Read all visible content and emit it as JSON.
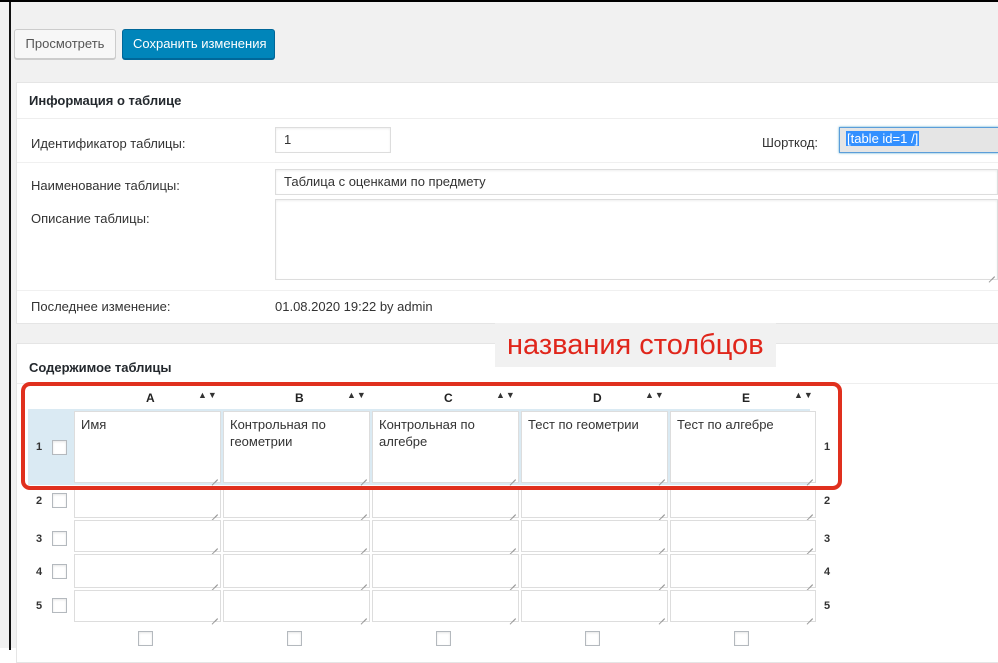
{
  "toolbar": {
    "preview_label": "Просмотреть",
    "save_label": "Сохранить изменения"
  },
  "info": {
    "title": "Информация о таблице",
    "id_label": "Идентификатор таблицы:",
    "id_value": "1",
    "shortcode_label": "Шорткод:",
    "shortcode_value": "[table id=1 /]",
    "name_label": "Наименование таблицы:",
    "name_value": "Таблица с оценками по предмету",
    "description_label": "Описание таблицы:",
    "description_value": "",
    "modified_label": "Последнее изменение:",
    "modified_value": "01.08.2020 19:22 by admin"
  },
  "annotation": "названия столбцов",
  "content": {
    "title": "Содержимое таблицы",
    "columns": [
      {
        "letter": "A",
        "arrows": "▲▼"
      },
      {
        "letter": "B",
        "arrows": "▲▼"
      },
      {
        "letter": "C",
        "arrows": "▲▼"
      },
      {
        "letter": "D",
        "arrows": "▲▼"
      },
      {
        "letter": "E",
        "arrows": "▲▼"
      }
    ],
    "rows": [
      {
        "num": "1",
        "cells": [
          "Имя",
          "Контрольная по геометрии",
          "Контрольная по алгебре",
          "Тест по геометрии",
          "Тест по алгебре"
        ]
      },
      {
        "num": "2",
        "cells": [
          "",
          "",
          "",
          "",
          ""
        ]
      },
      {
        "num": "3",
        "cells": [
          "",
          "",
          "",
          "",
          ""
        ]
      },
      {
        "num": "4",
        "cells": [
          "",
          "",
          "",
          "",
          ""
        ]
      },
      {
        "num": "5",
        "cells": [
          "",
          "",
          "",
          "",
          ""
        ]
      }
    ]
  },
  "colors": {
    "primary": "#0085ba",
    "annotation": "#e0261b",
    "selected_row": "#daeaf3"
  }
}
